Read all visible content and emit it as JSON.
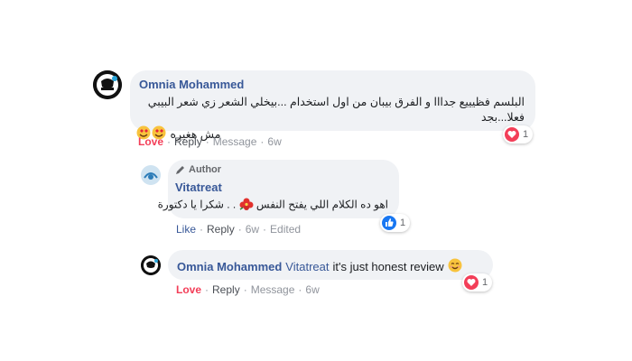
{
  "comments": [
    {
      "author": "Omnia Mohammed",
      "text_line1": "البلسم فظيييع جدااا و الفرق بيبان من اول استخدام ...بيخلي الشعر زي شعر البيبي فعلا...بجد",
      "text_line2": "مش هغيره",
      "actions": {
        "reaction": "Love",
        "reply": "Reply",
        "message": "Message",
        "time": "6w"
      },
      "reaction_count": "1",
      "avatar_label": "Omnia"
    },
    {
      "badge": "Author",
      "author": "Vitatreat",
      "text_part1": "اهو ده الكلام اللي يفتح النفس",
      "text_part2": ". . شكرا يا دكتورة",
      "actions": {
        "reaction": "Like",
        "reply": "Reply",
        "time": "6w",
        "edited": "Edited"
      },
      "reaction_count": "1"
    },
    {
      "author": "Omnia Mohammed",
      "mention": "Vitatreat",
      "text": "it's just honest review",
      "actions": {
        "reaction": "Love",
        "reply": "Reply",
        "message": "Message",
        "time": "6w"
      },
      "reaction_count": "1"
    }
  ],
  "colors": {
    "link": "#385898",
    "love": "#f33e58",
    "bubble": "#f0f2f5"
  }
}
